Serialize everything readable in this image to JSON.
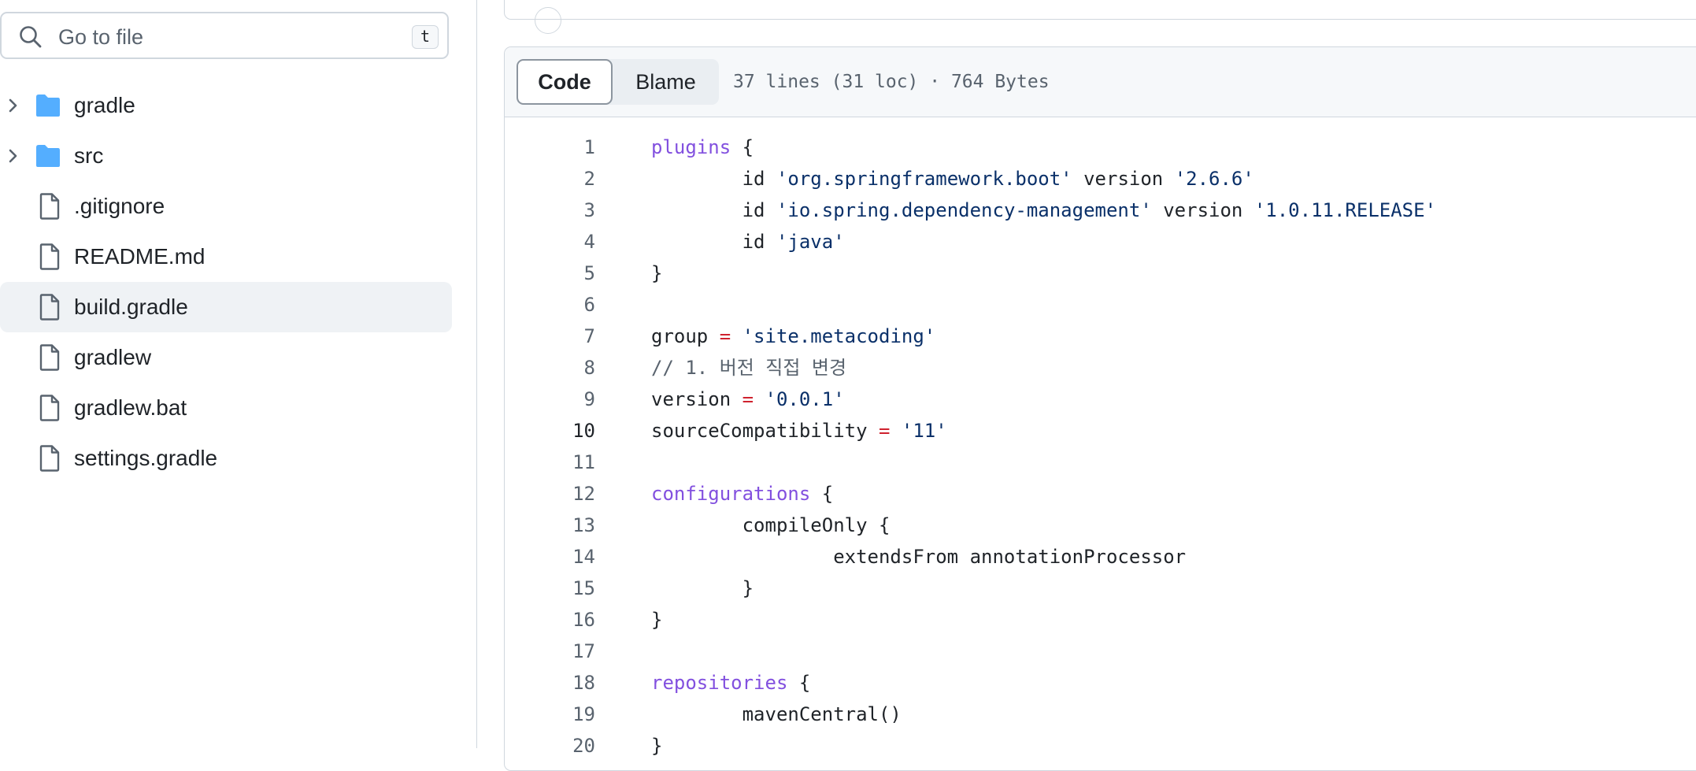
{
  "search": {
    "placeholder": "Go to file",
    "shortcut": "t"
  },
  "tree": [
    {
      "name": "gradle",
      "type": "folder",
      "icon": "folder-icon"
    },
    {
      "name": "src",
      "type": "folder",
      "icon": "folder-icon"
    },
    {
      "name": ".gitignore",
      "type": "file",
      "icon": "file-icon"
    },
    {
      "name": "README.md",
      "type": "file",
      "icon": "file-icon"
    },
    {
      "name": "build.gradle",
      "type": "file",
      "icon": "file-icon",
      "selected": true
    },
    {
      "name": "gradlew",
      "type": "file",
      "icon": "file-icon"
    },
    {
      "name": "gradlew.bat",
      "type": "file",
      "icon": "file-icon"
    },
    {
      "name": "settings.gradle",
      "type": "file",
      "icon": "file-icon"
    }
  ],
  "file_header": {
    "code_label": "Code",
    "blame_label": "Blame",
    "meta": "37 lines (31 loc) · 764 Bytes"
  },
  "colors": {
    "keyword": "#8250df",
    "string": "#0a3069",
    "operator": "#cf222e",
    "comment": "#59636e",
    "folder": "#54aeff",
    "selected_bg": "#eff2f5"
  },
  "code": {
    "active_line": 10,
    "lines": [
      {
        "n": "1",
        "tokens": [
          [
            "kw",
            "plugins"
          ],
          [
            "t",
            " {"
          ]
        ]
      },
      {
        "n": "2",
        "tokens": [
          [
            "t",
            "        id "
          ],
          [
            "str",
            "'org.springframework.boot'"
          ],
          [
            "t",
            " version "
          ],
          [
            "str",
            "'2.6.6'"
          ]
        ]
      },
      {
        "n": "3",
        "tokens": [
          [
            "t",
            "        id "
          ],
          [
            "str",
            "'io.spring.dependency-management'"
          ],
          [
            "t",
            " version "
          ],
          [
            "str",
            "'1.0.11.RELEASE'"
          ]
        ]
      },
      {
        "n": "4",
        "tokens": [
          [
            "t",
            "        id "
          ],
          [
            "str",
            "'java'"
          ]
        ]
      },
      {
        "n": "5",
        "tokens": [
          [
            "t",
            "}"
          ]
        ]
      },
      {
        "n": "6",
        "tokens": []
      },
      {
        "n": "7",
        "tokens": [
          [
            "t",
            "group "
          ],
          [
            "op",
            "="
          ],
          [
            "t",
            " "
          ],
          [
            "str",
            "'site.metacoding'"
          ]
        ]
      },
      {
        "n": "8",
        "tokens": [
          [
            "cm",
            "// 1. 버전 직접 변경"
          ]
        ]
      },
      {
        "n": "9",
        "tokens": [
          [
            "t",
            "version "
          ],
          [
            "op",
            "="
          ],
          [
            "t",
            " "
          ],
          [
            "str",
            "'0.0.1'"
          ]
        ]
      },
      {
        "n": "10",
        "tokens": [
          [
            "t",
            "sourceCompatibility "
          ],
          [
            "op",
            "="
          ],
          [
            "t",
            " "
          ],
          [
            "str",
            "'11'"
          ]
        ]
      },
      {
        "n": "11",
        "tokens": []
      },
      {
        "n": "12",
        "tokens": [
          [
            "kw",
            "configurations"
          ],
          [
            "t",
            " {"
          ]
        ]
      },
      {
        "n": "13",
        "tokens": [
          [
            "t",
            "        compileOnly {"
          ]
        ]
      },
      {
        "n": "14",
        "tokens": [
          [
            "t",
            "                extendsFrom annotationProcessor"
          ]
        ]
      },
      {
        "n": "15",
        "tokens": [
          [
            "t",
            "        }"
          ]
        ]
      },
      {
        "n": "16",
        "tokens": [
          [
            "t",
            "}"
          ]
        ]
      },
      {
        "n": "17",
        "tokens": []
      },
      {
        "n": "18",
        "tokens": [
          [
            "kw",
            "repositories"
          ],
          [
            "t",
            " {"
          ]
        ]
      },
      {
        "n": "19",
        "tokens": [
          [
            "t",
            "        mavenCentral()"
          ]
        ]
      },
      {
        "n": "20",
        "tokens": [
          [
            "t",
            "}"
          ]
        ]
      }
    ]
  }
}
